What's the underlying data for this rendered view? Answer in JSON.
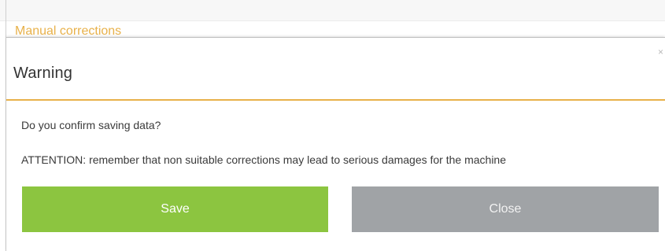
{
  "background": {
    "section_title": "Manual corrections"
  },
  "dialog": {
    "title": "Warning",
    "close_glyph": "×",
    "message_confirm": "Do you confirm saving data?",
    "message_attention": "ATTENTION: remember that non suitable corrections may lead to serious damages for the machine",
    "save_label": "Save",
    "close_label": "Close"
  },
  "colors": {
    "accent": "#e8b14a",
    "save": "#8cc540",
    "close": "#a0a3a6"
  }
}
